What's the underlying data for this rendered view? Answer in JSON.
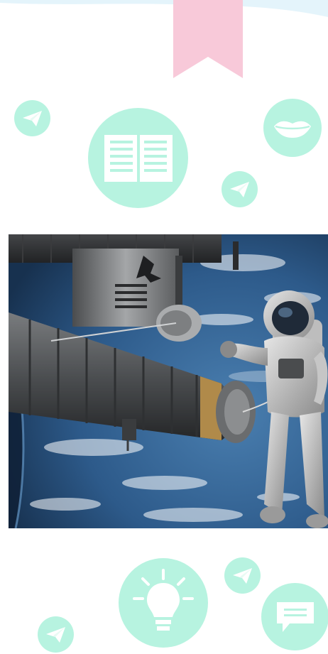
{
  "colors": {
    "mint": "#b7f3e0",
    "mint_light": "#c9f6e8",
    "pink": "#f8c9d9",
    "wave": "#e4f4fb",
    "white": "#ffffff"
  },
  "icons": {
    "bookmark": "bookmark-icon",
    "paper_plane": "paper-plane-icon",
    "open_book": "open-book-icon",
    "lips": "lips-icon",
    "lightbulb": "lightbulb-icon",
    "chat_bubble": "chat-bubble-icon"
  },
  "image": {
    "subject": "astronaut-spacewalk-photo"
  }
}
